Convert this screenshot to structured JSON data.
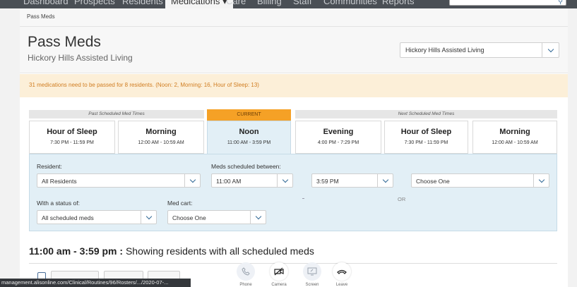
{
  "nav": {
    "items": [
      "Dashboard",
      "Prospects",
      "Residents",
      "Medications ▾",
      "Care",
      "Billing",
      "Staff",
      "Communities",
      "Reports"
    ],
    "active_index": 3
  },
  "breadcrumb": "Pass Meds",
  "header": {
    "title": "Pass Meds",
    "subtitle": "Hickory Hills Assisted Living",
    "community_select": "Hickory Hills Assisted Living"
  },
  "alert": {
    "text": "31 medications need to be passed for 8 residents. (Noon: 2, Morning: 16, Hour of Sleep: 13)",
    "color": "#d07d21"
  },
  "med_times": {
    "past_label": "Past Scheduled Med Times",
    "current_label": "CURRENT",
    "next_label": "Next Scheduled Med Times",
    "cards": [
      {
        "name": "Hour of Sleep",
        "range": "7:30 PM - 11:59 PM"
      },
      {
        "name": "Morning",
        "range": "12:00 AM - 10:59 AM"
      },
      {
        "name": "Noon",
        "range": "11:00 AM - 3:59 PM"
      },
      {
        "name": "Evening",
        "range": "4:00 PM - 7:29 PM"
      },
      {
        "name": "Hour of Sleep",
        "range": "7:30 PM - 11:59 PM"
      },
      {
        "name": "Morning",
        "range": "12:00 AM - 10:59 AM"
      }
    ]
  },
  "filters": {
    "resident_label": "Resident:",
    "resident_value": "All Residents",
    "meds_between_label": "Meds scheduled between:",
    "from_value": "11:00 AM",
    "to_value": "3:59 PM",
    "or_text": "OR",
    "choose_value": "Choose One",
    "status_label": "With a status of:",
    "status_value": "All scheduled meds",
    "cart_label": "Med cart:",
    "cart_value": "Choose One"
  },
  "results": {
    "range": "11:00 am - 3:59 pm :",
    "description": " Showing residents with all scheduled meds"
  },
  "status_bar": "management.alisonline.com/Clinical/Routines/96/Rosters/.../2020-07-...",
  "call_controls": [
    {
      "label": "Phone",
      "icon": "phone-icon"
    },
    {
      "label": "Camera",
      "icon": "camera-off-icon"
    },
    {
      "label": "Screen",
      "icon": "screen-share-icon"
    },
    {
      "label": "Leave",
      "icon": "hang-up-icon"
    }
  ],
  "colors": {
    "current_tab": "#f5a126",
    "filter_bg": "#e2eff6",
    "accent": "#336a96"
  }
}
